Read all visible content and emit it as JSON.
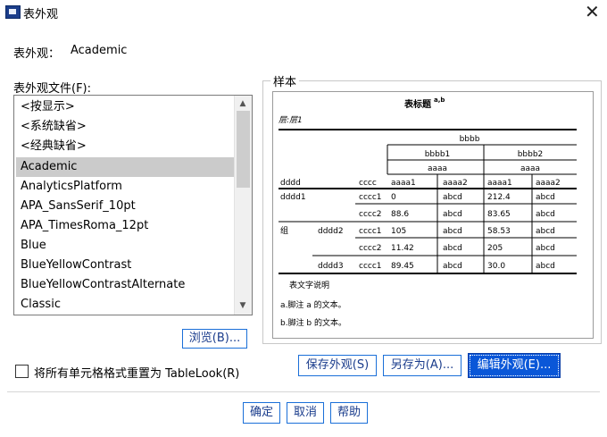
{
  "window": {
    "title": "表外观",
    "close_glyph": "✕"
  },
  "current_look": {
    "label": "表外观：",
    "value": "Academic"
  },
  "files": {
    "label": "表外观文件(F):",
    "items": [
      "<按显示>",
      "<系统缺省>",
      "<经典缺省>",
      "Academic",
      "AnalyticsPlatform",
      "APA_SansSerif_10pt",
      "APA_TimesRoma_12pt",
      "Blue",
      "BlueYellowContrast",
      "BlueYellowContrastAlternate",
      "Classic"
    ],
    "selected": "Academic"
  },
  "browse_button": "浏览(B)...",
  "reset_checkbox": {
    "label": "将所有单元格格式重置为 TableLook(R)",
    "checked": false
  },
  "sample_group": {
    "title": "样本",
    "table": {
      "title": "表标题",
      "title_sup": "a,b",
      "layer": "层:层1",
      "col_top": "bbbb",
      "col_mid": [
        "bbbb1",
        "bbbb2"
      ],
      "col_mid2": [
        "aaaa",
        "aaaa"
      ],
      "row_dim1": "dddd",
      "row_dim2": "cccc",
      "col_leaf": [
        "aaaa1",
        "aaaa2",
        "aaaa1",
        "aaaa2"
      ],
      "rows": [
        {
          "g": "",
          "d": "dddd1",
          "c": "cccc1",
          "v": [
            "0",
            "abcd",
            "212.4",
            "abcd"
          ]
        },
        {
          "g": "",
          "d": "",
          "c": "cccc2",
          "v": [
            "88.6",
            "abcd",
            "83.65",
            "abcd"
          ]
        },
        {
          "g": "组",
          "d": "dddd2",
          "c": "cccc1",
          "v": [
            "105",
            "abcd",
            "58.53",
            "abcd"
          ]
        },
        {
          "g": "",
          "d": "",
          "c": "cccc2",
          "v": [
            "11.42",
            "abcd",
            "205",
            "abcd"
          ]
        },
        {
          "g": "",
          "d": "dddd3",
          "c": "cccc1",
          "v": [
            "89.45",
            "abcd",
            "30.0",
            "abcd"
          ]
        }
      ],
      "caption": "表文字说明",
      "footnotes": [
        "a.脚注 a 的文本。",
        "b.脚注 b 的文本。"
      ]
    }
  },
  "sample_buttons": {
    "save": "保存外观(S)",
    "save_as": "另存为(A)...",
    "edit": "编辑外观(E)..."
  },
  "footer_buttons": {
    "ok": "确定",
    "cancel": "取消",
    "help": "帮助"
  },
  "icons": {
    "scroll_up": "▲",
    "scroll_down": "▼"
  },
  "colors": {
    "accent": "#0a57d8",
    "button_text": "#1a3c8c",
    "selection": "#cbcbcb"
  }
}
